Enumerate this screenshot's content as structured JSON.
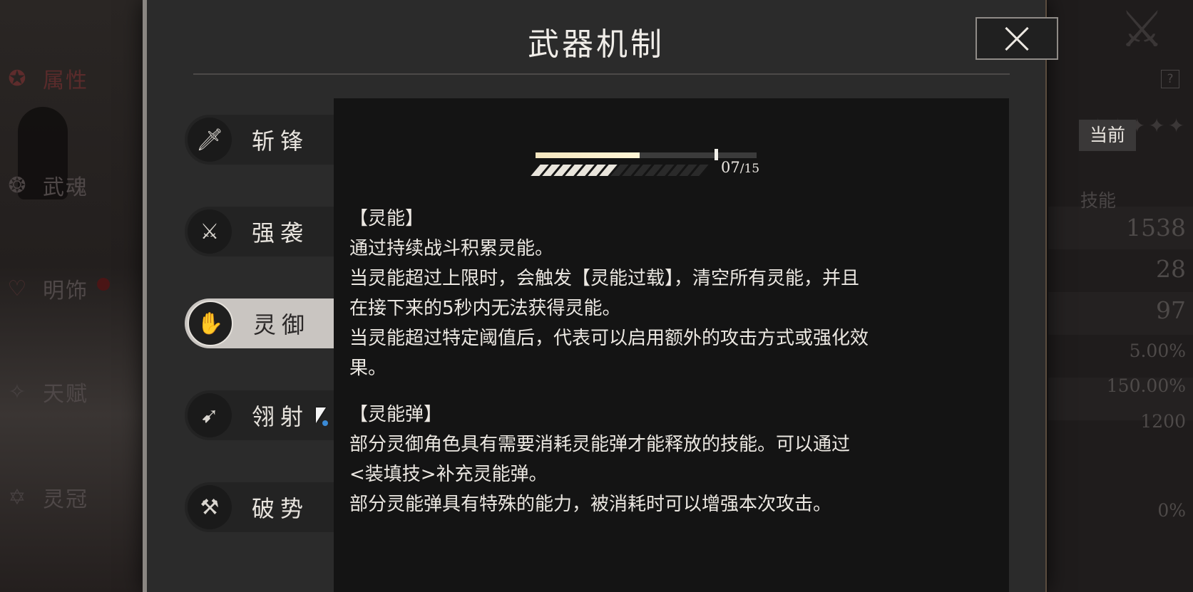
{
  "background": {
    "left_nav": [
      {
        "label": "属性",
        "icon": "star-icon"
      },
      {
        "label": "武魂",
        "icon": "spirit-icon"
      },
      {
        "label": "明饰",
        "icon": "ornament-icon"
      },
      {
        "label": "天赋",
        "icon": "talent-icon"
      },
      {
        "label": "灵冠",
        "icon": "crown-icon"
      }
    ],
    "right_panel": {
      "help_label": "?",
      "skill_title": "技能",
      "stats": [
        "1538",
        "28",
        "97",
        "5.00%",
        "150.00%",
        "1200",
        "0%"
      ]
    }
  },
  "modal": {
    "title": "武器机制",
    "close_label": "close",
    "tabs": [
      {
        "label": "斩锋",
        "icon": "blade-icon",
        "active": false
      },
      {
        "label": "强袭",
        "icon": "daggers-icon",
        "active": false
      },
      {
        "label": "灵御",
        "icon": "psi-icon",
        "active": true
      },
      {
        "label": "翎射",
        "icon": "arrow-icon",
        "active": false
      },
      {
        "label": "破势",
        "icon": "hammer-icon",
        "active": false
      }
    ],
    "current_badge": "当前",
    "gauge": {
      "current": "07",
      "max": "/15",
      "filled_segments": 7,
      "total_segments": 15,
      "bar_fill_fraction": 0.47,
      "marker_fraction": 0.81
    },
    "sections": [
      {
        "title": "【灵能】",
        "lines": [
          "通过持续战斗积累灵能。",
          "当灵能超过上限时，会触发【灵能过载】，清空所有灵能，并且",
          "在接下来的5秒内无法获得灵能。",
          "当灵能超过特定阈值后，代表可以启用额外的攻击方式或强化效",
          "果。"
        ]
      },
      {
        "title": "【灵能弹】",
        "lines": [
          "部分灵御角色具有需要消耗灵能弹才能释放的技能。可以通过",
          "<装填技>补充灵能弹。",
          "部分灵能弹具有特殊的能力，被消耗时可以增强本次攻击。"
        ]
      }
    ]
  },
  "colors": {
    "accent_fill": "#f4e6bf",
    "active_tab": "#c9c5c1",
    "panel_bg": "#141414",
    "modal_bg": "#2b2b2b"
  }
}
